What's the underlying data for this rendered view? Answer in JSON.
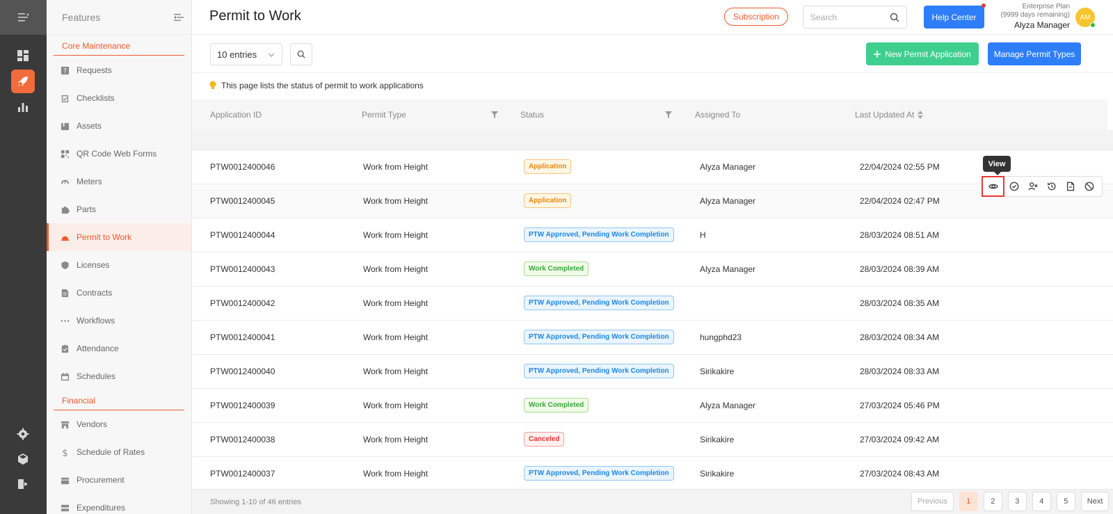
{
  "sidebar": {
    "title": "Features",
    "sections": [
      {
        "label": "Core Maintenance",
        "items": [
          {
            "label": "Requests",
            "icon": "help-icon"
          },
          {
            "label": "Checklists",
            "icon": "checklist-icon"
          },
          {
            "label": "Assets",
            "icon": "box-icon"
          },
          {
            "label": "QR Code Web Forms",
            "icon": "qr-icon"
          },
          {
            "label": "Meters",
            "icon": "gauge-icon"
          },
          {
            "label": "Parts",
            "icon": "puzzle-icon"
          },
          {
            "label": "Permit to Work",
            "icon": "helmet-icon",
            "active": true
          },
          {
            "label": "Licenses",
            "icon": "shield-icon"
          },
          {
            "label": "Contracts",
            "icon": "contract-icon"
          },
          {
            "label": "Workflows",
            "icon": "dots-icon"
          },
          {
            "label": "Attendance",
            "icon": "clipboard-icon"
          },
          {
            "label": "Schedules",
            "icon": "calendar-icon"
          }
        ]
      },
      {
        "label": "Financial",
        "items": [
          {
            "label": "Vendors",
            "icon": "store-icon"
          },
          {
            "label": "Schedule of Rates",
            "icon": "dollar-icon"
          },
          {
            "label": "Procurement",
            "icon": "procurement-icon"
          },
          {
            "label": "Expenditures",
            "icon": "expenditure-icon"
          }
        ]
      }
    ]
  },
  "header": {
    "title": "Permit to Work",
    "subscription_label": "Subscription",
    "search_placeholder": "Search",
    "help_label": "Help Center",
    "plan_name": "Enterprise Plan",
    "plan_remaining": "(9999 days remaining)",
    "user_name": "Alyza Manager",
    "avatar_initials": "AM"
  },
  "toolbar": {
    "entries_label": "10 entries",
    "new_label": "New Permit Application",
    "manage_label": "Manage Permit Types"
  },
  "info_text": "This page lists the status of permit to work applications",
  "table": {
    "columns": [
      "Application ID",
      "Permit Type",
      "Status",
      "Assigned To",
      "Last Updated At"
    ],
    "rows": [
      {
        "id": "PTW0012400046",
        "type": "Work from Height",
        "status": "Application",
        "status_kind": "app",
        "assigned": "Alyza Manager",
        "updated": "22/04/2024 02:55 PM"
      },
      {
        "id": "PTW0012400045",
        "type": "Work from Height",
        "status": "Application",
        "status_kind": "app",
        "assigned": "Alyza Manager",
        "updated": "22/04/2024 02:47 PM"
      },
      {
        "id": "PTW0012400044",
        "type": "Work from Height",
        "status": "PTW Approved, Pending Work Completion",
        "status_kind": "ptw",
        "assigned": "H",
        "updated": "28/03/2024 08:51 AM"
      },
      {
        "id": "PTW0012400043",
        "type": "Work from Height",
        "status": "Work Completed",
        "status_kind": "done",
        "assigned": "Alyza Manager",
        "updated": "28/03/2024 08:39 AM"
      },
      {
        "id": "PTW0012400042",
        "type": "Work from Height",
        "status": "PTW Approved, Pending Work Completion",
        "status_kind": "ptw",
        "assigned": "",
        "updated": "28/03/2024 08:35 AM"
      },
      {
        "id": "PTW0012400041",
        "type": "Work from Height",
        "status": "PTW Approved, Pending Work Completion",
        "status_kind": "ptw",
        "assigned": "hungphd23",
        "updated": "28/03/2024 08:34 AM"
      },
      {
        "id": "PTW0012400040",
        "type": "Work from Height",
        "status": "PTW Approved, Pending Work Completion",
        "status_kind": "ptw",
        "assigned": "Sirikakire",
        "updated": "28/03/2024 08:33 AM"
      },
      {
        "id": "PTW0012400039",
        "type": "Work from Height",
        "status": "Work Completed",
        "status_kind": "done",
        "assigned": "Alyza Manager",
        "updated": "27/03/2024 05:46 PM"
      },
      {
        "id": "PTW0012400038",
        "type": "Work from Height",
        "status": "Canceled",
        "status_kind": "cancel",
        "assigned": "Sirikakire",
        "updated": "27/03/2024 09:42 AM"
      },
      {
        "id": "PTW0012400037",
        "type": "Work from Height",
        "status": "PTW Approved, Pending Work Completion",
        "status_kind": "ptw",
        "assigned": "Sirikakire",
        "updated": "27/03/2024 08:43 AM"
      }
    ]
  },
  "row_actions": {
    "tooltip": "View",
    "icons": [
      "eye-icon",
      "check-circle-icon",
      "assign-icon",
      "history-icon",
      "document-icon",
      "ban-icon"
    ]
  },
  "footer": {
    "showing": "Showing 1-10 of 46 entries",
    "prev_label": "Previous",
    "pages": [
      "1",
      "2",
      "3",
      "4",
      "5"
    ],
    "current_page": "1",
    "next_label": "Next"
  },
  "colors": {
    "brand": "#ee5a2c",
    "primary": "#2d7ef8",
    "success": "#3ecf8e",
    "rail": "#3a3a3a"
  }
}
